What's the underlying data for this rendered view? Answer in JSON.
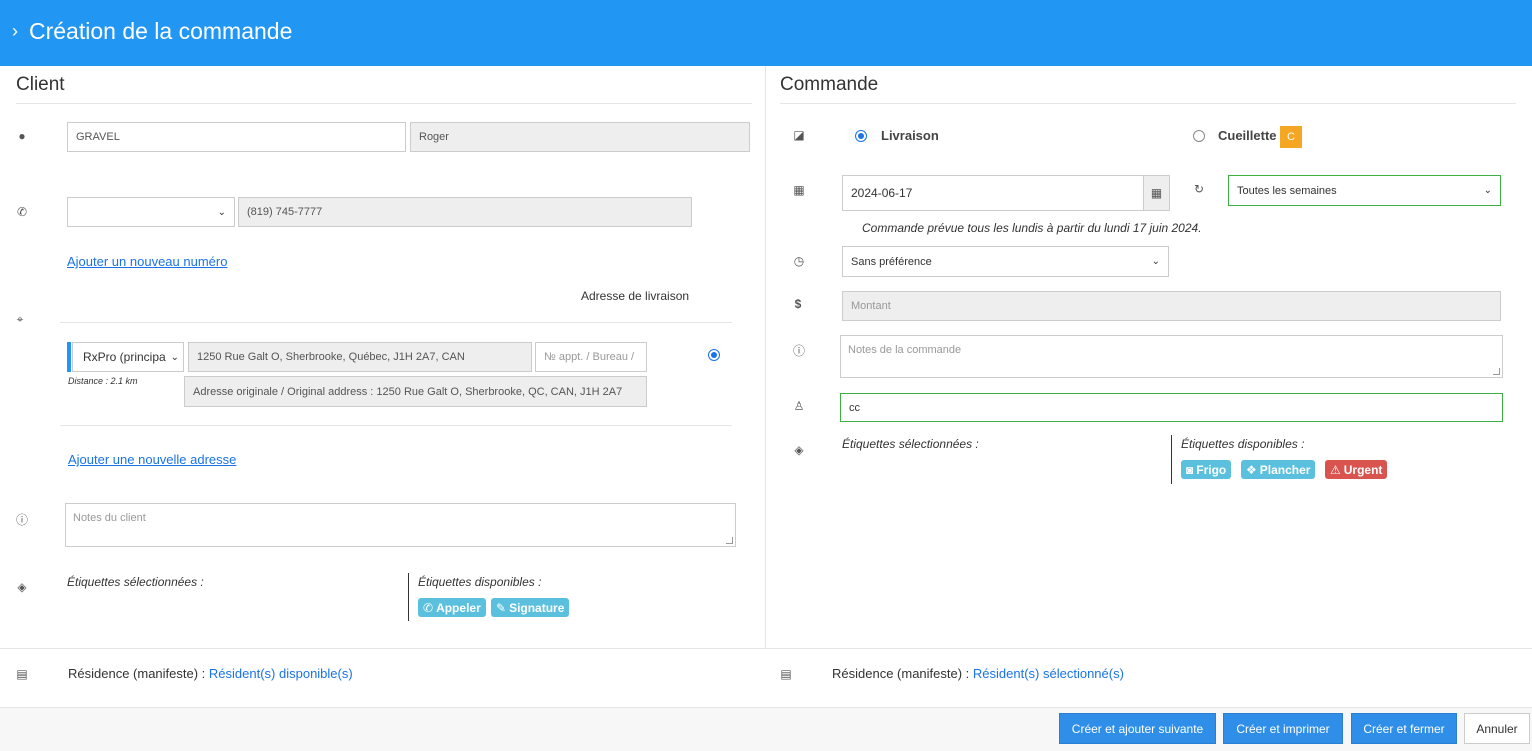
{
  "header": {
    "title": "Création de la commande"
  },
  "client": {
    "title": "Client",
    "last_name": "GRAVEL",
    "first_name": "Roger",
    "phone_type": "",
    "phone": "(819) 745-7777",
    "add_phone_link": "Ajouter un nouveau numéro",
    "delivery_address_label": "Adresse de livraison",
    "address_select": "RxPro (principa",
    "address": "1250 Rue Galt O, Sherbrooke, Québec, J1H 2A7, CAN",
    "apt_placeholder": "№ appt. / Bureau /",
    "distance": "Distance : 2.1 km",
    "original_address": "Adresse originale / Original address : 1250 Rue Galt O, Sherbrooke, QC, CAN, J1H 2A7",
    "add_address_link": "Ajouter une nouvelle adresse",
    "notes_placeholder": "Notes du client",
    "tags_selected_label": "Étiquettes sélectionnées :",
    "tags_available_label": "Étiquettes disponibles :",
    "tags_available": [
      {
        "label": "Appeler",
        "icon": "phone-icon"
      },
      {
        "label": "Signature",
        "icon": "edit-icon"
      }
    ],
    "residence_label": "Résidence (manifeste) :",
    "residence_link": "Résident(s) disponible(s)"
  },
  "order": {
    "title": "Commande",
    "delivery_label": "Livraison",
    "pickup_label": "Cueillette",
    "pickup_badge": "C",
    "date": "2024-06-17",
    "recurrence": "Toutes les semaines",
    "schedule_note": "Commande prévue tous les lundis à partir du lundi 17 juin 2024.",
    "time_pref": "Sans préférence",
    "amount_placeholder": "Montant",
    "notes_placeholder": "Notes de la commande",
    "person_value": "cc",
    "tags_selected_label": "Étiquettes sélectionnées :",
    "tags_available_label": "Étiquettes disponibles :",
    "tags_available": [
      {
        "label": "Frigo",
        "icon": "camera-icon"
      },
      {
        "label": "Plancher",
        "icon": "cubes-icon"
      },
      {
        "label": "Urgent",
        "icon": "warning-icon"
      }
    ],
    "residence_label": "Résidence (manifeste) :",
    "residence_link": "Résident(s) sélectionné(s)"
  },
  "footer": {
    "create_next": "Créer et ajouter suivante",
    "create_print": "Créer et imprimer",
    "create_close": "Créer et fermer",
    "cancel": "Annuler"
  },
  "colors": {
    "header": "#2196f3",
    "primary": "#2e8ee8",
    "info_tag": "#5bc0de",
    "danger_tag": "#d9534f",
    "badge": "#f5a623",
    "valid_border": "#3cb043"
  }
}
